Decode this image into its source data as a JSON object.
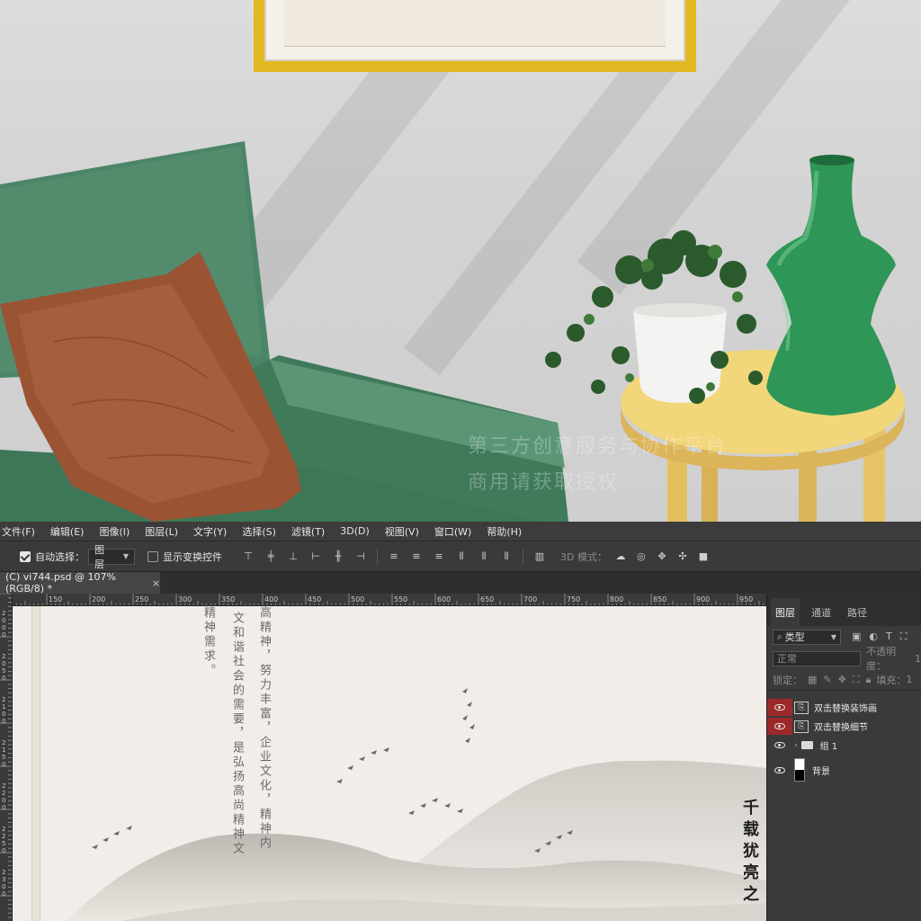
{
  "scene": {
    "watermark_line1": "第三方创意服务与协作平台",
    "watermark_line2": "商用请获取授权"
  },
  "menu": [
    "文件(F)",
    "编辑(E)",
    "图像(I)",
    "图层(L)",
    "文字(Y)",
    "选择(S)",
    "滤镜(T)",
    "3D(D)",
    "视图(V)",
    "窗口(W)",
    "帮助(H)"
  ],
  "options": {
    "auto_select_label": "自动选择：",
    "auto_select_checked": true,
    "auto_select_target": "图层",
    "show_transform_label": "显示变换控件",
    "show_transform_checked": false,
    "mode_3d_label": "3D 模式："
  },
  "document": {
    "tab_title": "(C) vi744.psd @ 107%(RGB/8) *",
    "close_symbol": "×"
  },
  "ruler": {
    "h_ticks": [
      "150",
      "200",
      "250",
      "300",
      "350",
      "400",
      "450",
      "500",
      "550",
      "600",
      "650",
      "700",
      "750",
      "800",
      "850",
      "900",
      "950"
    ],
    "v_ticks": [
      "2000",
      "2050",
      "2100",
      "2150",
      "2200",
      "2250",
      "2300"
    ]
  },
  "canvas_text": {
    "col1": "精神需求。",
    "col2": "文和谐社会的需要，是弘扬高尚精神文",
    "col3": "高精神，努力丰富，企业文化，精神内",
    "calligraphy": "千载犹亮之"
  },
  "layers_panel": {
    "tabs": [
      "图层",
      "通道",
      "路径"
    ],
    "active_tab": "图层",
    "filter_label": "类型",
    "blend_mode": "正常",
    "opacity_label": "不透明度：",
    "opacity_value": "1",
    "lock_label": "锁定：",
    "fill_label": "填充：",
    "fill_value": "1",
    "layers": [
      {
        "name": "双击替换装饰画",
        "type": "smart-object",
        "visible": true,
        "highlight": true
      },
      {
        "name": "双击替换细节",
        "type": "smart-object",
        "visible": true,
        "highlight": true
      },
      {
        "name": "组 1",
        "type": "group",
        "visible": true,
        "highlight": false
      },
      {
        "name": "背景",
        "type": "background",
        "visible": true,
        "highlight": false
      }
    ]
  },
  "colors": {
    "accent_red": "#9b2929",
    "frame_gold": "#e1b821",
    "chair_green": "#4c8a69",
    "pillow_brown": "#9c5635",
    "table_yellow": "#f1d274",
    "vase_green": "#2f9a58"
  }
}
